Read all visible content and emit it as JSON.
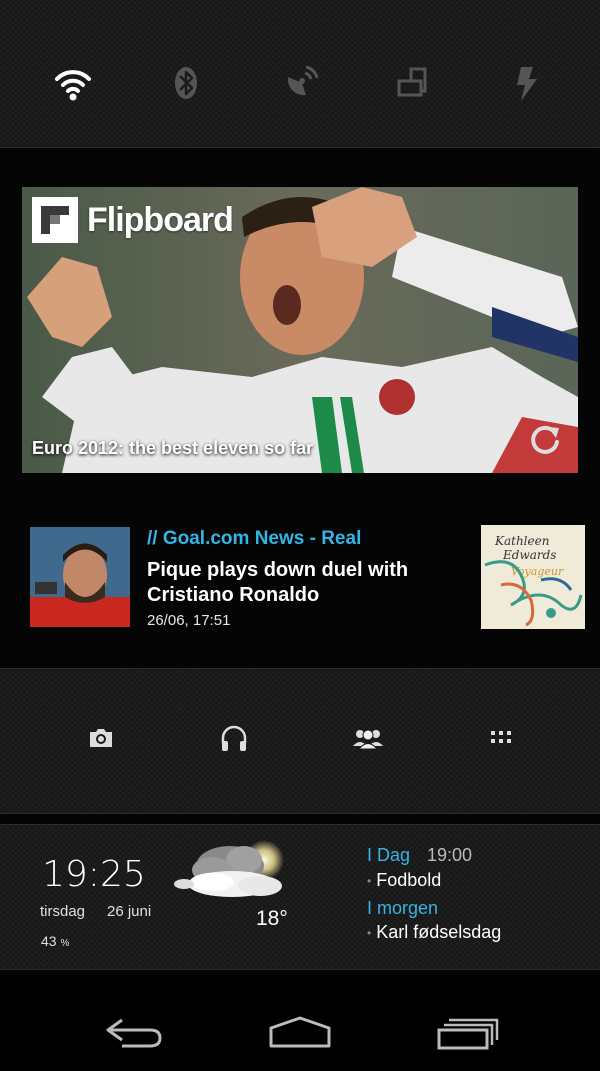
{
  "quick_toggles": [
    {
      "icon": "wifi-icon",
      "active": true
    },
    {
      "icon": "bluetooth-icon",
      "active": false
    },
    {
      "icon": "gps-icon",
      "active": false
    },
    {
      "icon": "auto-rotate-icon",
      "active": false
    },
    {
      "icon": "flash-icon",
      "active": false
    }
  ],
  "flipboard": {
    "brand": "Flipboard",
    "headline": "Euro 2012: the best eleven so far",
    "refresh_icon": "refresh-icon"
  },
  "news": {
    "source": "// Goal.com News - Real",
    "title": "Pique plays down duel with Cristiano Ronaldo",
    "timestamp": "26/06, 17:51",
    "album_art_text": "Kathleen Edwards Voyageur"
  },
  "dock": [
    {
      "icon": "camera-icon"
    },
    {
      "icon": "headphones-icon"
    },
    {
      "icon": "people-icon"
    },
    {
      "icon": "app-drawer-icon"
    }
  ],
  "clock_widget": {
    "time": "19:25",
    "weekday": "tirsdag",
    "date": "26 juni",
    "battery_value": "43",
    "battery_unit": "%",
    "temperature": "18°",
    "weather_icon": "partly-cloudy-icon",
    "calendar": [
      {
        "header": "I Dag",
        "time": "19:00",
        "event": "Fodbold"
      },
      {
        "header": "I morgen",
        "time": "",
        "event": "Karl fødselsdag"
      }
    ],
    "accent_color": "#33b5e5"
  },
  "navigation": [
    {
      "icon": "back-icon"
    },
    {
      "icon": "home-icon"
    },
    {
      "icon": "recent-apps-icon"
    }
  ]
}
